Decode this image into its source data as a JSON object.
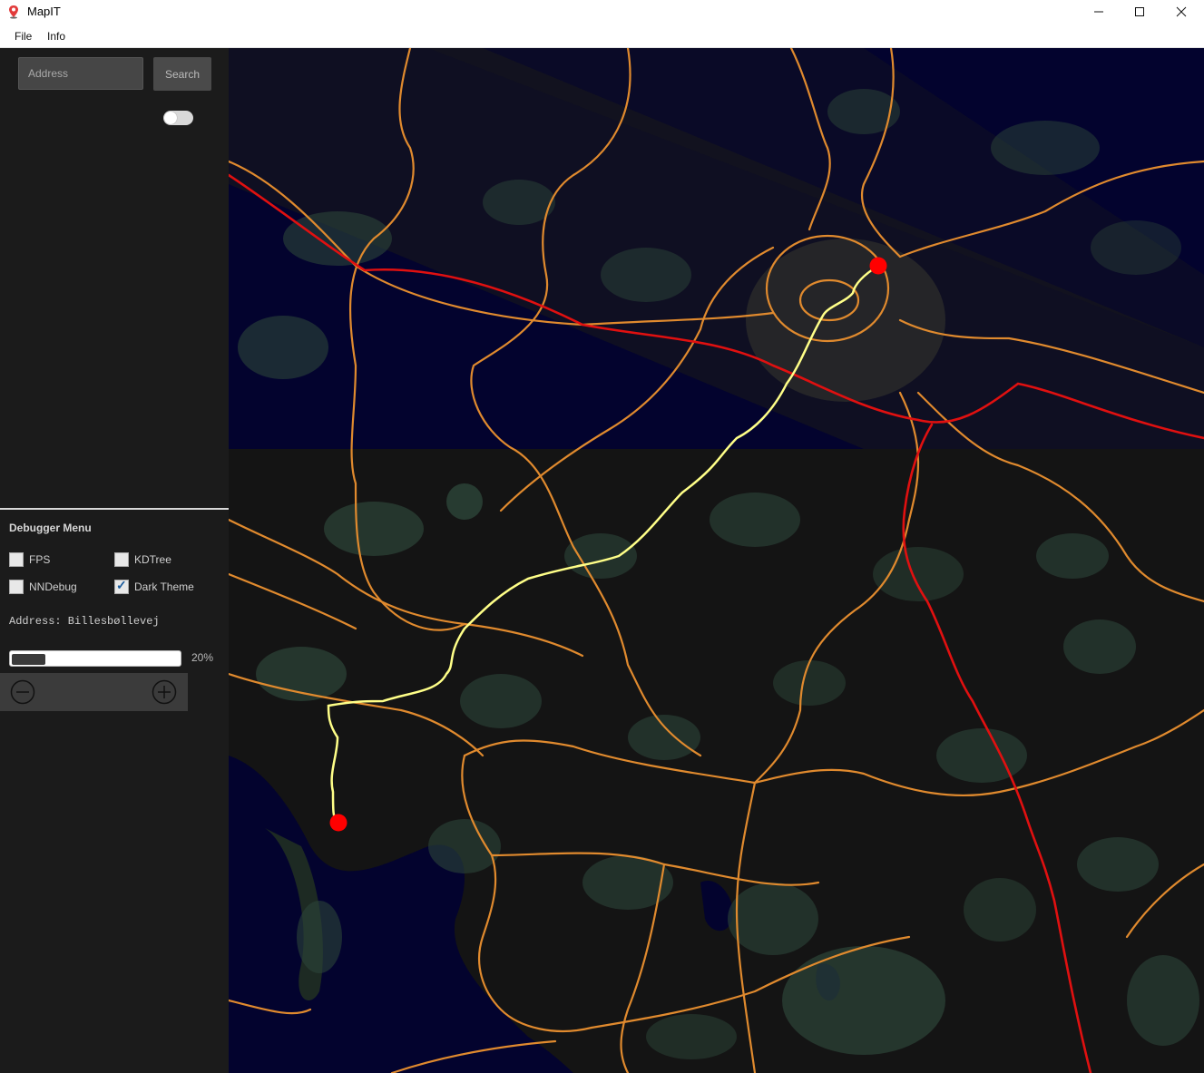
{
  "window": {
    "title": "MapIT"
  },
  "menu": {
    "file": "File",
    "info": "Info"
  },
  "search": {
    "placeholder": "Address",
    "button_label": "Search"
  },
  "debugger": {
    "title": "Debugger Menu",
    "options": [
      {
        "label": "FPS",
        "checked": false
      },
      {
        "label": "KDTree",
        "checked": false
      },
      {
        "label": "NNDebug",
        "checked": false
      },
      {
        "label": "Dark Theme",
        "checked": true
      }
    ],
    "address_text": "Address: Billesbøllevej",
    "progress_percent": 20,
    "progress_label": "20%"
  },
  "colors": {
    "water": "#03032e",
    "land": "#141414",
    "forest": "#2c4538",
    "road_primary": "#e08a2e",
    "motorway": "#e01010",
    "route": "#ffff88",
    "marker": "#ff0000"
  },
  "icons": [
    "map-pin-icon",
    "minimize-icon",
    "maximize-icon",
    "close-icon",
    "zoom-out-icon",
    "zoom-in-icon"
  ]
}
